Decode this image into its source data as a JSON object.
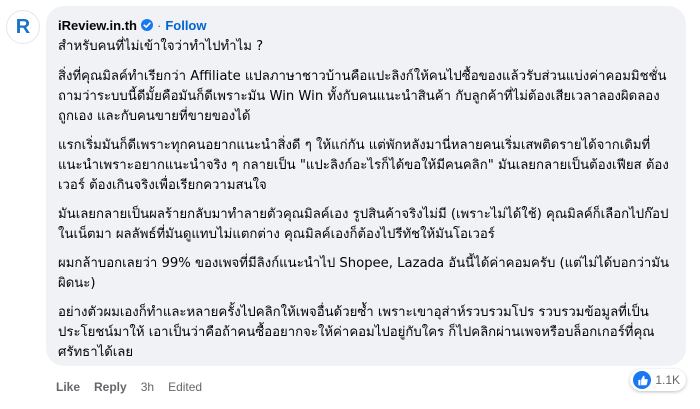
{
  "comment": {
    "avatar_letter": "R",
    "author": "iReview.in.th",
    "separator": "·",
    "follow_label": "Follow",
    "paragraphs": [
      "สำหรับคนที่ไม่เข้าใจว่าทำไปทำไม ?",
      "สิ่งที่คุณมิลค์ทำเรียกว่า Affiliate แปลภาษาชาวบ้านคือแปะลิงก์ให้คนไปซื้อของแล้วรับส่วนแบ่งค่าคอมมิชชั่น ถามว่าระบบนี้ดีมั้ยคือมันก็ดีเพราะมัน Win Win ทั้งกับคนแนะนำสินค้า กับลูกค้าที่ไม่ต้องเสียเวลาลองผิดลองถูกเอง และกับคนขายที่ขายของได้",
      "แรกเริ่มมันก็ดีเพราะทุกคนอยากแนะนำสิ่งดี ๆ ให้แก่กัน แต่พักหลังมานี่หลายคนเริ่มเสพติดรายได้จากเดิมที่แนะนำเพราะอยากแนะนำจริง ๆ กลายเป็น \"แปะลิงก์อะไรก็ได้ขอให้มีคนคลิก\" มันเลยกลายเป็นต้องเฟียส ต้องเวอร์ ต้องเกินจริงเพื่อเรียกความสนใจ",
      "มันเลยกลายเป็นผลร้ายกลับมาทำลายตัวคุณมิลค์เอง รูปสินค้าจริงไม่มี (เพราะไม่ได้ใช้) คุณมิลค์ก็เลือกไปก๊อปในเน็ตมา ผลลัพธ์ที่มันดูแทบไม่แตกต่าง คุณมิลค์เองก็ต้องไปรีทัชให้มันโอเวอร์",
      "ผมกล้าบอกเลยว่า 99% ของเพจที่มีลิงก์แนะนำไป Shopee, Lazada อันนี้ได้ค่าคอมครับ (แต่ไม่ได้บอกว่ามันผิดนะ)",
      "อย่างตัวผมเองก็ทำและหลายครั้งไปคลิกให้เพจอื่นด้วยซ้ำ เพราะเขาอุส่าห์รวบรวมโปร รวบรวมข้อมูลที่เป็นประโยชน์มาให้ เอาเป็นว่าคือถ้าคนซื้ออยากจะให้ค่าคอมไปอยู่กับใคร ก็ไปคลิกผ่านเพจหรือบล็อกเกอร์ที่คุณศรัทธาได้เลย"
    ]
  },
  "actions": {
    "like_label": "Like",
    "reply_label": "Reply",
    "time": "3h",
    "edited": "Edited"
  },
  "reactions": {
    "count": "1.1K",
    "icon": "like-icon",
    "color": "#1877f2"
  },
  "colors": {
    "bubble": "#f0f2f5",
    "follow": "#0064d1",
    "verified": "#1877f2",
    "muted": "#65676b"
  }
}
